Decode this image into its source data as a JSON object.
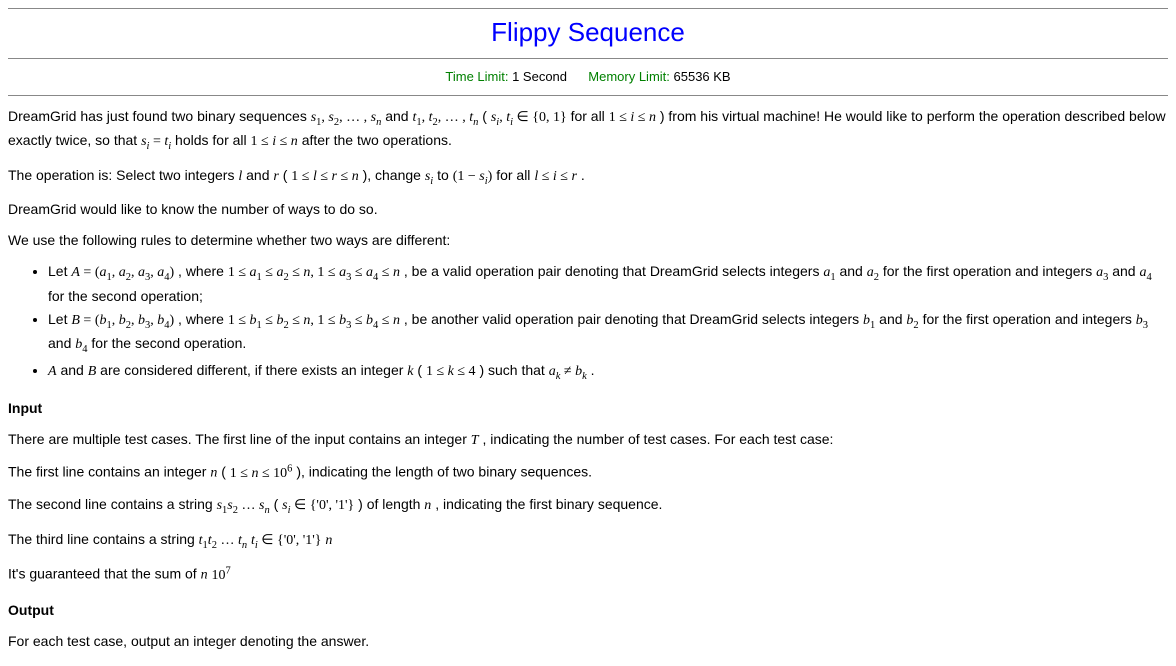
{
  "title": "Flippy Sequence",
  "limits": {
    "time_label": "Time Limit:",
    "time_value": " 1 Second",
    "memory_label": "Memory Limit:",
    "memory_value": " 65536 KB"
  },
  "intro_1_a": "DreamGrid has just found two binary sequences ",
  "intro_1_seq1": "s₁, s₂, … , sₙ",
  "intro_1_b": " and ",
  "intro_1_seq2": "t₁, t₂, … , tₙ",
  "intro_1_c": " (",
  "intro_1_dom": "sᵢ, tᵢ ∈ {0, 1}",
  "intro_1_d": " for all ",
  "intro_1_rng": "1 ≤ i ≤ n",
  "intro_1_e": ") from his virtual machine! He would like to perform the operation described below exactly twice, so that ",
  "intro_1_eq": "sᵢ = tᵢ",
  "intro_1_f": " holds for all ",
  "intro_1_rng2": "1 ≤ i ≤ n",
  "intro_1_g": " after the two operations.",
  "op_a": "The operation is: Select two integers ",
  "op_l": "l",
  "op_b": " and ",
  "op_r": "r",
  "op_c": " (",
  "op_rng": "1 ≤ l ≤ r ≤ n",
  "op_d": "), change ",
  "op_si": "sᵢ",
  "op_e": " to ",
  "op_exp": "(1 − sᵢ)",
  "op_f": " for all ",
  "op_rng2": "l ≤ i ≤ r",
  "op_g": ".",
  "intro_2": "DreamGrid would like to know the number of ways to do so.",
  "intro_3": "We use the following rules to determine whether two ways are different:",
  "bul1_a": "Let ",
  "bul1_A": "A = (a₁, a₂, a₃, a₄)",
  "bul1_b": ", where ",
  "bul1_rng": "1 ≤ a₁ ≤ a₂ ≤ n, 1 ≤ a₃ ≤ a₄ ≤ n",
  "bul1_c": ", be a valid operation pair denoting that DreamGrid selects integers ",
  "bul1_a1": "a₁",
  "bul1_d": " and ",
  "bul1_a2": "a₂",
  "bul1_e": " for the first operation and integers ",
  "bul1_a3": "a₃",
  "bul1_f": " and ",
  "bul1_a4": "a₄",
  "bul1_g": " for the second operation;",
  "bul2_a": "Let ",
  "bul2_B": "B = (b₁, b₂, b₃, b₄)",
  "bul2_b": ", where ",
  "bul2_rng": "1 ≤ b₁ ≤ b₂ ≤ n, 1 ≤ b₃ ≤ b₄ ≤ n",
  "bul2_c": ", be another valid operation pair denoting that DreamGrid selects integers ",
  "bul2_b1": "b₁",
  "bul2_d": " and ",
  "bul2_b2": "b₂",
  "bul2_e": " for the first operation and integers ",
  "bul2_b3": "b₃",
  "bul2_f": " and ",
  "bul2_b4": "b₄",
  "bul2_g": " for the second operation.",
  "bul3_A": "A",
  "bul3_a": " and ",
  "bul3_B": "B",
  "bul3_b": " are considered different, if there exists an integer ",
  "bul3_k": "k",
  "bul3_c": " (",
  "bul3_rng": "1 ≤ k ≤ 4",
  "bul3_d": ") such that ",
  "bul3_neq": "aₖ ≠ bₖ",
  "bul3_e": ".",
  "input_head": "Input",
  "in1_a": "There are multiple test cases. The first line of the input contains an integer ",
  "in1_T": "T",
  "in1_b": ", indicating the number of test cases. For each test case:",
  "in2_a": "The first line contains an integer ",
  "in2_n": "n",
  "in2_b": " (",
  "in2_rng": "1 ≤ n ≤ 10⁶",
  "in2_c": "), indicating the length of two binary sequences.",
  "in3_a": "The second line contains a string ",
  "in3_s": "s₁s₂ … sₙ",
  "in3_b": " (",
  "in3_dom": "sᵢ ∈ {'0', '1'}",
  "in3_c": ") of length ",
  "in3_n": "n",
  "in3_d": ", indicating the first binary sequence.",
  "in4_a": "The third line contains a string ",
  "in4_t": "t₁t₂ … tₙ",
  "in4_dom": "tᵢ ∈ {'0', '1'}",
  "in4_n": "n",
  "in5_a": "It's guaranteed that the sum of ",
  "in5_n": "n",
  "in5_lim": "10⁷",
  "output_head": "Output",
  "out1": "For each test case, output an integer denoting the answer."
}
